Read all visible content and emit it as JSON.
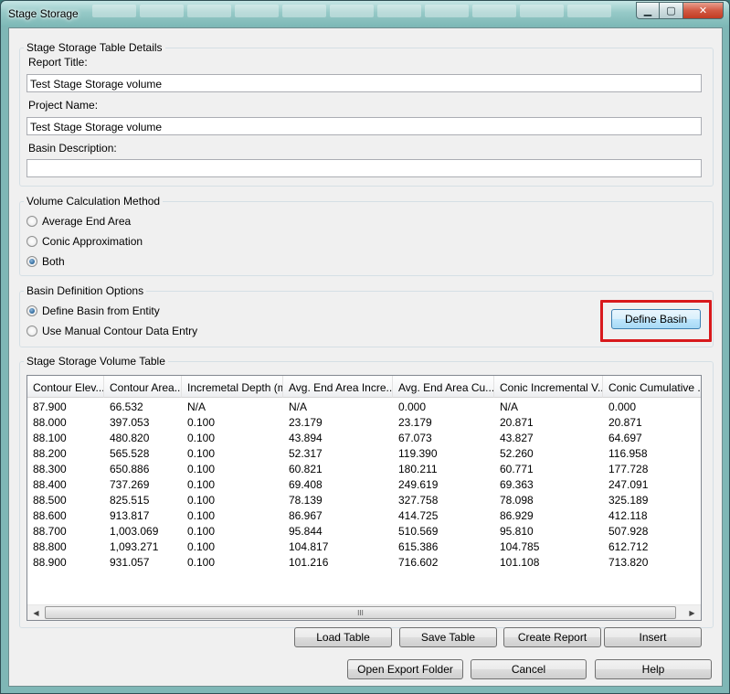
{
  "window": {
    "title": "Stage Storage"
  },
  "details": {
    "group_title": "Stage Storage Table Details",
    "report_title_label": "Report Title:",
    "report_title_value": "Test Stage Storage volume",
    "project_name_label": "Project Name:",
    "project_name_value": "Test Stage Storage volume",
    "basin_description_label": "Basin Description:",
    "basin_description_value": ""
  },
  "volume_method": {
    "group_title": "Volume Calculation Method",
    "options": [
      {
        "label": "Average End Area",
        "selected": false
      },
      {
        "label": "Conic Approximation",
        "selected": false
      },
      {
        "label": "Both",
        "selected": true
      }
    ]
  },
  "basin_options": {
    "group_title": "Basin Definition Options",
    "options": [
      {
        "label": "Define Basin from Entity",
        "selected": true
      },
      {
        "label": "Use Manual Contour Data Entry",
        "selected": false
      }
    ],
    "define_basin_label": "Define Basin",
    "highlight_color": "#d8191c"
  },
  "volume_table": {
    "group_title": "Stage Storage Volume Table",
    "columns": [
      "Contour Elev...",
      "Contour Area...",
      "Incremetal Depth (m)",
      "Avg. End Area Incre...",
      "Avg. End Area Cu...",
      "Conic Incremental V...",
      "Conic Cumulative ..."
    ],
    "rows": [
      [
        "87.900",
        "66.532",
        "N/A",
        "N/A",
        "0.000",
        "N/A",
        "0.000"
      ],
      [
        "88.000",
        "397.053",
        "0.100",
        "23.179",
        "23.179",
        "20.871",
        "20.871"
      ],
      [
        "88.100",
        "480.820",
        "0.100",
        "43.894",
        "67.073",
        "43.827",
        "64.697"
      ],
      [
        "88.200",
        "565.528",
        "0.100",
        "52.317",
        "119.390",
        "52.260",
        "116.958"
      ],
      [
        "88.300",
        "650.886",
        "0.100",
        "60.821",
        "180.211",
        "60.771",
        "177.728"
      ],
      [
        "88.400",
        "737.269",
        "0.100",
        "69.408",
        "249.619",
        "69.363",
        "247.091"
      ],
      [
        "88.500",
        "825.515",
        "0.100",
        "78.139",
        "327.758",
        "78.098",
        "325.189"
      ],
      [
        "88.600",
        "913.817",
        "0.100",
        "86.967",
        "414.725",
        "86.929",
        "412.118"
      ],
      [
        "88.700",
        "1,003.069",
        "0.100",
        "95.844",
        "510.569",
        "95.810",
        "507.928"
      ],
      [
        "88.800",
        "1,093.271",
        "0.100",
        "104.817",
        "615.386",
        "104.785",
        "612.712"
      ],
      [
        "88.900",
        "931.057",
        "0.100",
        "101.216",
        "716.602",
        "101.108",
        "713.820"
      ]
    ],
    "scroll_thumb_grip": "III"
  },
  "table_buttons": {
    "load": "Load Table",
    "save": "Save Table",
    "report": "Create Report",
    "insert": "Insert"
  },
  "footer_buttons": {
    "open_export": "Open Export Folder",
    "cancel": "Cancel",
    "help": "Help"
  }
}
